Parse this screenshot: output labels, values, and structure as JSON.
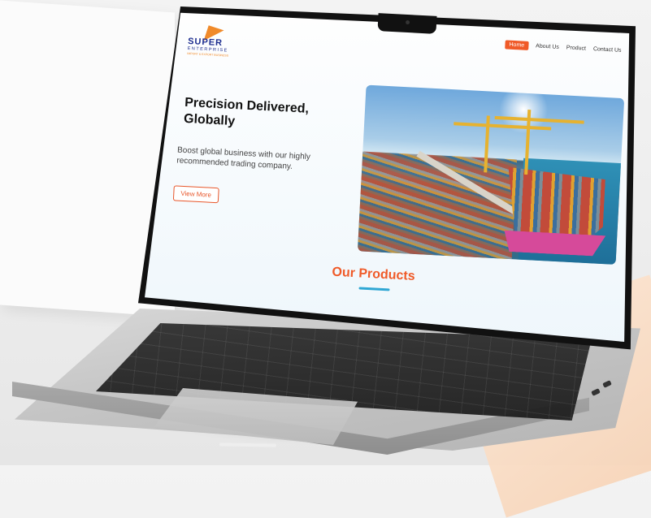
{
  "site": {
    "logo": {
      "word": "SUPER",
      "sub": "ENTERPRISE",
      "tagline": "IMPORT & EXPORT BUSINESS"
    },
    "nav": {
      "items": [
        {
          "label": "Home",
          "active": true
        },
        {
          "label": "About Us",
          "active": false
        },
        {
          "label": "Product",
          "active": false
        },
        {
          "label": "Contact Us",
          "active": false
        }
      ]
    },
    "hero": {
      "title_line1": "Precision Delivered,",
      "title_line2": "Globally",
      "description": "Boost global business with our highly recommended trading company.",
      "button_label": "View More"
    },
    "products": {
      "title": "Our Products"
    }
  },
  "colors": {
    "accent": "#f05a28",
    "brand_blue": "#1c2d8f",
    "underline": "#2fa7d4"
  }
}
